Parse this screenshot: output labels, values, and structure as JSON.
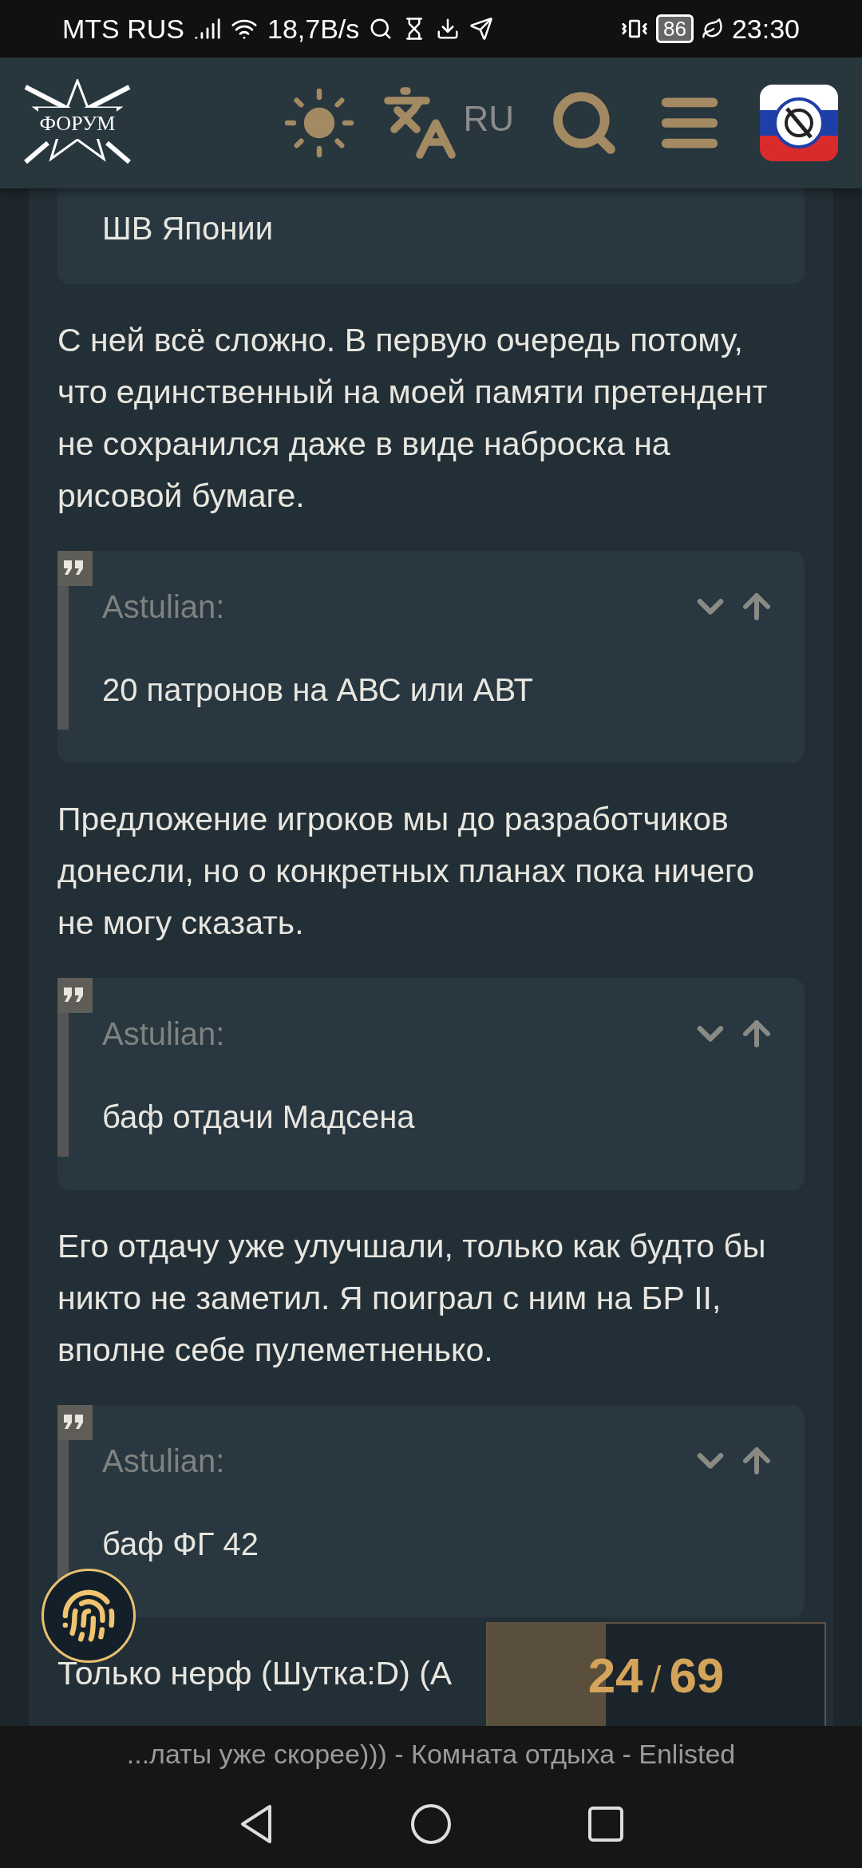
{
  "status_bar": {
    "carrier": "MTS RUS",
    "speed": "18,7B/s",
    "battery": "86",
    "time": "23:30"
  },
  "header": {
    "logo_text": "ФОРУМ",
    "language": "RU"
  },
  "posts": [
    {
      "kind": "quote",
      "text": "ШВ Японии"
    },
    {
      "kind": "paragraph",
      "text": "С ней всё сложно. В первую очередь потому, что единственный на моей памяти претендент не сохранился даже в виде наброска на рисовой бумаге."
    },
    {
      "kind": "quote",
      "author": "Astulian:",
      "text": "20 патронов на АВС или АВТ"
    },
    {
      "kind": "paragraph",
      "text": "Предложение игроков мы до разработчиков донесли, но о конкретных планах пока ничего не могу сказать."
    },
    {
      "kind": "quote",
      "author": "Astulian:",
      "text": "баф отдачи Мадсена"
    },
    {
      "kind": "paragraph",
      "text": "Его отдачу уже улучшали, только как будто бы никто не заметил. Я поиграл с ним на БР II, вполне себе пулеметненько."
    },
    {
      "kind": "quote",
      "author": "Astulian:",
      "text": "баф ФГ 42"
    },
    {
      "kind": "paragraph",
      "text": "Только нерф (Шутка:D) (А"
    }
  ],
  "page_counter": {
    "current": "24",
    "separator": "/",
    "total": "69",
    "level": 0.35
  },
  "browser_title": "...латы уже скорее))) - Комната отдыха - Enlisted"
}
